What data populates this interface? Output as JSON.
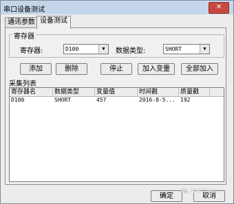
{
  "window": {
    "title": "串口设备测试",
    "close": "✕"
  },
  "tabs": [
    {
      "label": "通讯参数",
      "active": false
    },
    {
      "label": "设备测试",
      "active": true
    }
  ],
  "register_group": {
    "title": "寄存器",
    "register_label": "寄存器:",
    "register_value": "D100",
    "type_label": "数据类型:",
    "type_value": "SHORT"
  },
  "buttons": {
    "add": "添加",
    "delete": "删除",
    "stop": "停止",
    "add_var": "加入变量",
    "add_all": "全部加入"
  },
  "collect": {
    "title": "采集列表",
    "columns": [
      "寄存器名",
      "数据类型",
      "变量值",
      "时间戳",
      "质量戳"
    ],
    "rows": [
      [
        "D100",
        "SHORT",
        "457",
        "2016-8-5...",
        "192"
      ]
    ]
  },
  "footer": {
    "ok": "确定",
    "cancel": "取消"
  },
  "watermark": {
    "text": "我爱学PLC"
  },
  "colors": {
    "titlebar": "#c6d6ea",
    "close": "#c9483e",
    "panel": "#f0f0f0"
  }
}
